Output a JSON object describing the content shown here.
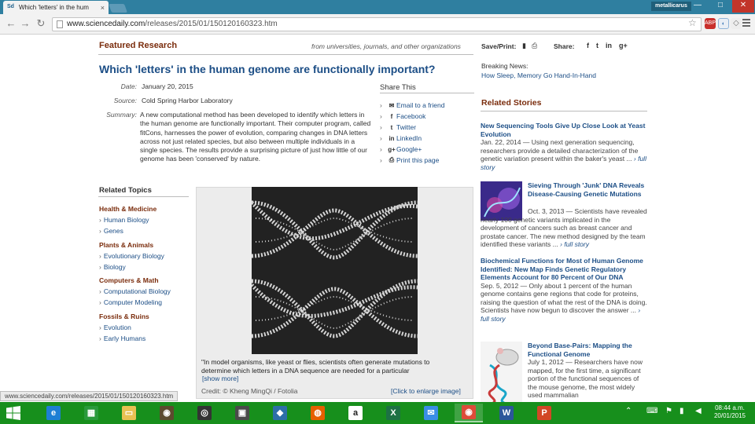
{
  "browser": {
    "tab_title": "Which 'letters' in the hum",
    "tab_favicon": "Sd",
    "tab_close": "×",
    "user_badge": "metallicarus",
    "url_host": "www.sciencedaily.com",
    "url_path": "/releases/2015/01/150120160323.htm",
    "status_url": "www.sciencedaily.com/releases/2015/01/150120160323.htm",
    "ext_badge_label": "ABP",
    "window_controls": {
      "minimize": "—",
      "maximize": "□",
      "close": "✕"
    }
  },
  "article": {
    "section": "Featured Research",
    "source_note": "from universities, journals, and other organizations",
    "title": "Which 'letters' in the human genome are functionally important?",
    "date_label": "Date:",
    "date_value": "January 20, 2015",
    "source_label": "Source:",
    "source_value": "Cold Spring Harbor Laboratory",
    "summary_label": "Summary:",
    "summary_value": "A new computational method has been developed to identify which letters in the human genome are functionally important. Their computer program, called fitCons, harnesses the power of evolution, comparing changes in DNA letters across not just related species, but also between multiple individuals in a single species. The results provide a surprising picture of just how little of our genome has been 'conserved' by nature."
  },
  "share_this": {
    "title": "Share This",
    "items": [
      {
        "label": "Email to a friend",
        "icon": "envelope-icon"
      },
      {
        "label": "Facebook",
        "icon": "facebook-icon"
      },
      {
        "label": "Twitter",
        "icon": "twitter-icon"
      },
      {
        "label": "LinkedIn",
        "icon": "linkedin-icon"
      },
      {
        "label": "Google+",
        "icon": "googleplus-icon"
      },
      {
        "label": "Print this page",
        "icon": "printer-icon"
      }
    ]
  },
  "related_topics": {
    "title": "Related Topics",
    "categories": [
      {
        "name": "Health & Medicine",
        "items": [
          "Human Biology",
          "Genes"
        ]
      },
      {
        "name": "Plants & Animals",
        "items": [
          "Evolutionary Biology",
          "Biology"
        ]
      },
      {
        "name": "Computers & Math",
        "items": [
          "Computational Biology",
          "Computer Modeling"
        ]
      },
      {
        "name": "Fossils & Ruins",
        "items": [
          "Evolution",
          "Early Humans"
        ]
      }
    ]
  },
  "figure": {
    "caption": "\"In model organisms, like yeast or flies, scientists often generate mutations to determine which letters in a DNA sequence are needed for a particular",
    "show_more": "[show more]",
    "credit": "Credit: © Kheng MingQi / Fotolia",
    "enlarge": "[Click to enlarge image]"
  },
  "sidebar": {
    "save_print": "Save/Print:",
    "share_label": "Share:",
    "breaking_title": "Breaking News:",
    "breaking_link": "How Sleep, Memory Go Hand-In-Hand",
    "related_title": "Related Stories",
    "stories": [
      {
        "title": "New Sequencing Tools Give Up Close Look at Yeast Evolution",
        "date": "Jan. 22, 2014",
        "body": "Using next generation sequencing, researchers provide a detailed characterization of the genetic variation present within the baker's yeast ...",
        "more": "full story"
      },
      {
        "title": "Sieving Through 'Junk' DNA Reveals Disease-Causing Genetic Mutations",
        "date": "Oct. 3, 2013",
        "body": "Scientists have revealed nearly 100 genetic variants implicated in the development of cancers such as breast cancer and prostate cancer. The new method designed by the team identified these variants ...",
        "more": "full story"
      },
      {
        "title": "Biochemical Functions for Most of Human Genome Identified: New Map Finds Genetic Regulatory Elements Account for 80 Percent of Our DNA",
        "date": "Sep. 5, 2012",
        "body": "Only about 1 percent of the human genome contains gene regions that code for proteins, raising the question of what the rest of the DNA is doing. Scientists have now begun to discover the answer ...",
        "more": "full story"
      },
      {
        "title": "Beyond Base-Pairs: Mapping the Functional Genome",
        "date": "July 1, 2012",
        "body": "Researchers have now mapped, for the first time, a significant portion of the functional sequences of the mouse genome, the most widely used mammalian",
        "more": ""
      }
    ]
  },
  "taskbar": {
    "time": "08:44 a.m.",
    "date": "20/01/2015",
    "apps": [
      {
        "name": "internet-explorer",
        "color": "#1e7fd4",
        "glyph": "e"
      },
      {
        "name": "store",
        "color": "#2a9a3b",
        "glyph": "▦"
      },
      {
        "name": "file-explorer",
        "color": "#e8c152",
        "glyph": "▭"
      },
      {
        "name": "app-1",
        "color": "#5b4b2e",
        "glyph": "◉"
      },
      {
        "name": "app-2",
        "color": "#333333",
        "glyph": "◎"
      },
      {
        "name": "app-3",
        "color": "#4a4a4a",
        "glyph": "▣"
      },
      {
        "name": "app-4",
        "color": "#2d6fa8",
        "glyph": "◆"
      },
      {
        "name": "firefox",
        "color": "#e66000",
        "glyph": "◍"
      },
      {
        "name": "amazon",
        "color": "#ffffff",
        "glyph": "a"
      },
      {
        "name": "excel",
        "color": "#1d7144",
        "glyph": "X"
      },
      {
        "name": "mail",
        "color": "#3a8ee6",
        "glyph": "✉"
      },
      {
        "name": "chrome",
        "color": "#dd4b39",
        "glyph": "◉"
      },
      {
        "name": "word",
        "color": "#2b579a",
        "glyph": "W"
      },
      {
        "name": "powerpoint",
        "color": "#d24726",
        "glyph": "P"
      }
    ]
  },
  "colors": {
    "link": "#1c4e86",
    "section_brown": "#7a2c0c",
    "taskbar_green": "#178f1c",
    "chrome_frame": "#2f7fa0"
  }
}
